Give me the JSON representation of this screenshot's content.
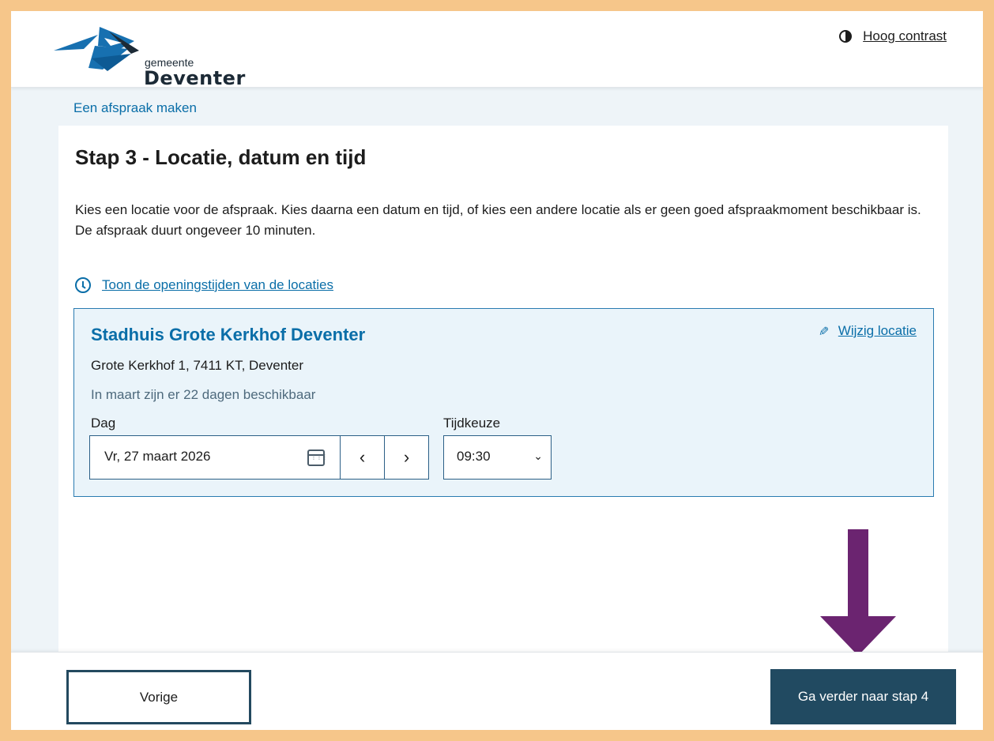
{
  "header": {
    "logo_small": "gemeente",
    "logo_big": "Deventer",
    "contrast_label": "Hoog contrast"
  },
  "breadcrumb": "Een afspraak maken",
  "step": {
    "title": "Stap 3 - Locatie, datum en tijd",
    "intro_line1": "Kies een locatie voor de afspraak. Kies daarna een datum en tijd, of kies een andere locatie als er geen goed afspraakmoment beschikbaar is.",
    "intro_line2": "De afspraak duurt ongeveer 10 minuten.",
    "hours_link": "Toon de openingstijden van de locaties"
  },
  "location": {
    "name": "Stadhuis Grote Kerkhof Deventer",
    "edit_link": "Wijzig locatie",
    "address": "Grote Kerkhof 1, 7411 KT, Deventer",
    "availability": "In maart zijn er 22 dagen beschikbaar",
    "day_label": "Dag",
    "day_value": "Vr, 27 maart 2026",
    "time_label": "Tijdkeuze",
    "time_value": "09:30"
  },
  "footer": {
    "prev_label": "Vorige",
    "next_label": "Ga verder naar stap 4"
  },
  "colors": {
    "accent": "#0a6ea8",
    "primary_button": "#214a61",
    "annotation_arrow": "#6b2470",
    "frame": "#f6c68a"
  },
  "icons": [
    "contrast-icon",
    "clock-icon",
    "pencil-icon",
    "calendar-icon",
    "chevron-left-icon",
    "chevron-right-icon",
    "chevron-down-icon",
    "arrow-down-icon"
  ]
}
